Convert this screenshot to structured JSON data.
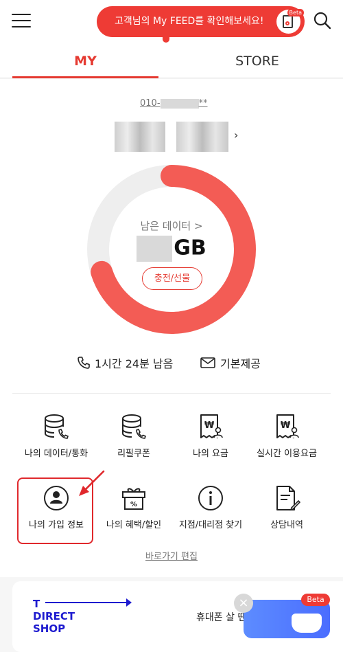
{
  "header": {
    "feed_message": "고객님의 My FEED를 확인해보세요!",
    "feed_badge": "Beta",
    "icons": [
      "menu-icon",
      "feed-document-icon",
      "search-icon"
    ]
  },
  "tabs": [
    {
      "label": "MY",
      "active": true
    },
    {
      "label": "STORE",
      "active": false
    }
  ],
  "account": {
    "phone_prefix": "010-",
    "phone_suffix": "**"
  },
  "data_usage": {
    "label": "남은 데이터 >",
    "unit": "GB",
    "charge_label": "충전/선물",
    "remaining_fraction": 0.7,
    "ring_color": "#f35c55"
  },
  "usage_info": {
    "call": "1시간 24분 남음",
    "sms": "기본제공"
  },
  "menu": {
    "items": [
      {
        "label": "나의 데이터/통화",
        "icon": "database-phone-icon"
      },
      {
        "label": "리필쿠폰",
        "icon": "database-phone-icon"
      },
      {
        "label": "나의 요금",
        "icon": "won-bill-user-icon"
      },
      {
        "label": "실시간 이용요금",
        "icon": "won-bill-user-icon"
      },
      {
        "label": "나의 가입 정보",
        "icon": "user-circle-icon",
        "highlighted": true
      },
      {
        "label": "나의 혜택/할인",
        "icon": "gift-percent-icon"
      },
      {
        "label": "지점/대리점 찾기",
        "icon": "info-circle-icon"
      },
      {
        "label": "상담내역",
        "icon": "document-pen-icon"
      }
    ],
    "edit_label": "바로가기 편집"
  },
  "banner": {
    "logo_line1": "T",
    "logo_line2": "DIRECT",
    "logo_line3": "SHOP",
    "text": "휴대폰 살 땐",
    "float_badge": "Beta",
    "float_close": "×"
  },
  "colors": {
    "accent": "#e53a31",
    "feed_pill": "#ee3b35",
    "brand_blue": "#1e1bcf",
    "annotation_red": "#e0282c"
  }
}
